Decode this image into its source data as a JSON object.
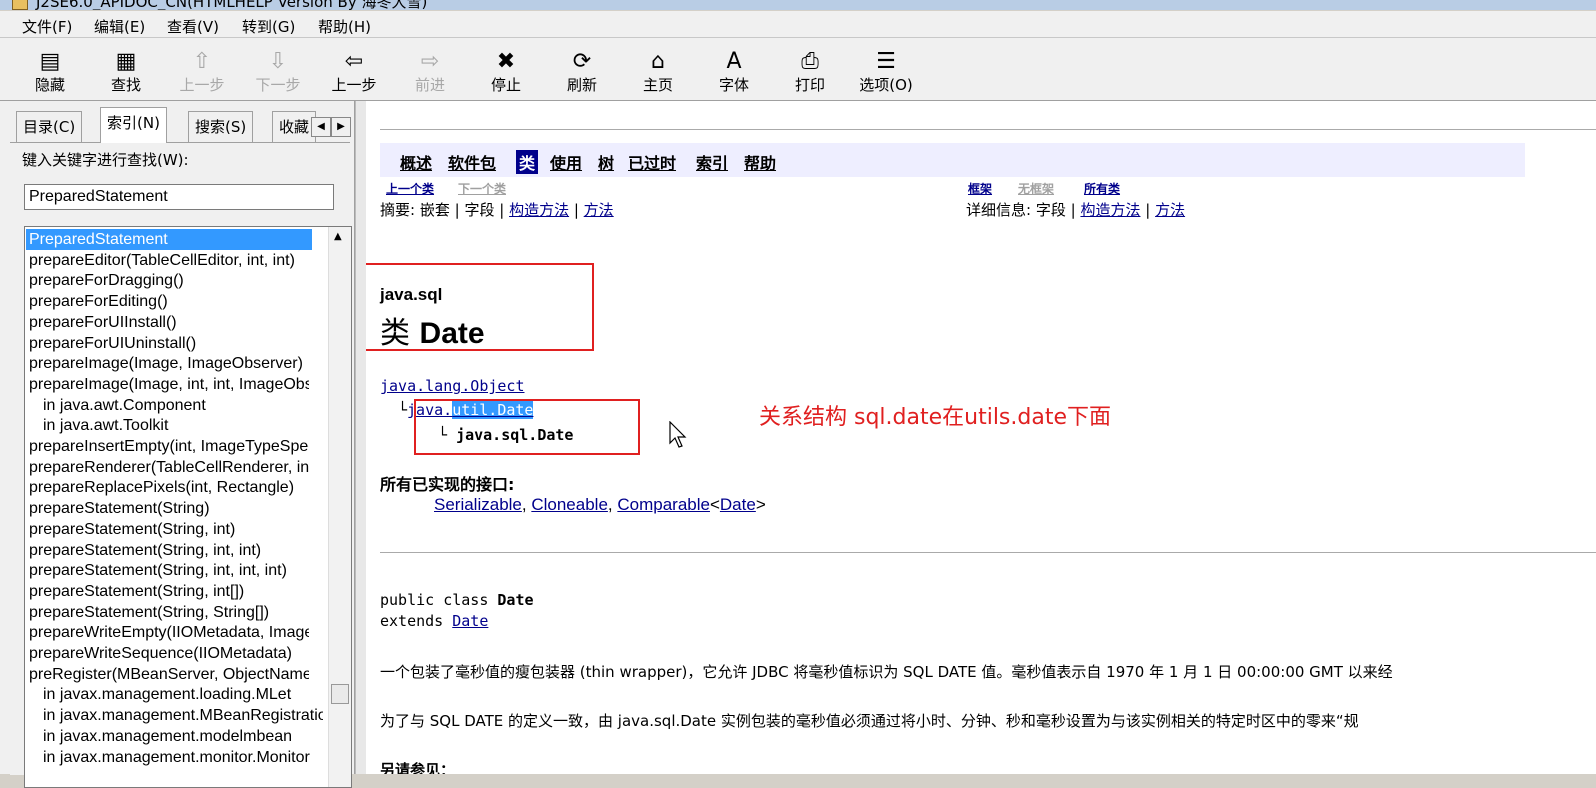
{
  "window": {
    "title": "J2SE6.0_APIDOC_CN(HTMLHELP Version By 海冬大雪)"
  },
  "menu": [
    "文件(F)",
    "编辑(E)",
    "查看(V)",
    "转到(G)",
    "帮助(H)"
  ],
  "toolbar": [
    {
      "label": "隐藏",
      "icon": "hide-icon",
      "glyph": "▤",
      "enabled": true
    },
    {
      "label": "查找",
      "icon": "locate-icon",
      "glyph": "▦",
      "enabled": true
    },
    {
      "label": "上一步",
      "icon": "up-arrow-icon",
      "glyph": "⇧",
      "enabled": false
    },
    {
      "label": "下一步",
      "icon": "down-arrow-icon",
      "glyph": "⇩",
      "enabled": false
    },
    {
      "label": "上一步",
      "icon": "back-arrow-icon",
      "glyph": "⇦",
      "enabled": true
    },
    {
      "label": "前进",
      "icon": "forward-arrow-icon",
      "glyph": "⇨",
      "enabled": false
    },
    {
      "label": "停止",
      "icon": "stop-icon",
      "glyph": "✖",
      "enabled": true
    },
    {
      "label": "刷新",
      "icon": "refresh-icon",
      "glyph": "⟳",
      "enabled": true
    },
    {
      "label": "主页",
      "icon": "home-icon",
      "glyph": "⌂",
      "enabled": true
    },
    {
      "label": "字体",
      "icon": "font-icon",
      "glyph": "A",
      "enabled": true
    },
    {
      "label": "打印",
      "icon": "print-icon",
      "glyph": "⎙",
      "enabled": true
    },
    {
      "label": "选项(O)",
      "icon": "options-icon",
      "glyph": "☰",
      "enabled": true
    }
  ],
  "tabs": [
    "目录(C)",
    "索引(N)",
    "搜索(S)",
    "收藏"
  ],
  "index": {
    "label": "键入关键字进行查找(W):",
    "query": "PreparedStatement",
    "items": [
      {
        "text": "PreparedStatement",
        "sub": false
      },
      {
        "text": "prepareEditor(TableCellEditor, int, int)",
        "sub": false
      },
      {
        "text": "prepareForDragging()",
        "sub": false
      },
      {
        "text": "prepareForEditing()",
        "sub": false
      },
      {
        "text": "prepareForUIInstall()",
        "sub": false
      },
      {
        "text": "prepareForUIUninstall()",
        "sub": false
      },
      {
        "text": "prepareImage(Image, ImageObserver)",
        "sub": false
      },
      {
        "text": "prepareImage(Image, int, int, ImageObserver)",
        "sub": false
      },
      {
        "text": "in java.awt.Component",
        "sub": true
      },
      {
        "text": "in java.awt.Toolkit",
        "sub": true
      },
      {
        "text": "prepareInsertEmpty(int, ImageTypeSpecifier)",
        "sub": false
      },
      {
        "text": "prepareRenderer(TableCellRenderer, int, int)",
        "sub": false
      },
      {
        "text": "prepareReplacePixels(int, Rectangle)",
        "sub": false
      },
      {
        "text": "prepareStatement(String)",
        "sub": false
      },
      {
        "text": "prepareStatement(String, int)",
        "sub": false
      },
      {
        "text": "prepareStatement(String, int, int)",
        "sub": false
      },
      {
        "text": "prepareStatement(String, int, int, int)",
        "sub": false
      },
      {
        "text": "prepareStatement(String, int[])",
        "sub": false
      },
      {
        "text": "prepareStatement(String, String[])",
        "sub": false
      },
      {
        "text": "prepareWriteEmpty(IIOMetadata, ImageTypeSpecifier)",
        "sub": false
      },
      {
        "text": "prepareWriteSequence(IIOMetadata)",
        "sub": false
      },
      {
        "text": "preRegister(MBeanServer, ObjectName)",
        "sub": false
      },
      {
        "text": "in javax.management.loading.MLet",
        "sub": true
      },
      {
        "text": "in javax.management.MBeanRegistration",
        "sub": true
      },
      {
        "text": "in javax.management.modelmbean",
        "sub": true
      },
      {
        "text": "in javax.management.monitor.Monitor",
        "sub": true
      }
    ]
  },
  "doc": {
    "nav": [
      "概述",
      "软件包",
      "类",
      "使用",
      "树",
      "已过时",
      "索引",
      "帮助"
    ],
    "nav_current": "类",
    "prev_class": "上一个类",
    "next_class": "下一个类",
    "frames": "框架",
    "no_frames": "无框架",
    "all_classes": "所有类",
    "summary_label": "摘要:",
    "summary_nested": "嵌套",
    "summary_field": "字段",
    "summary_ctor": "构造方法",
    "summary_method": "方法",
    "detail_label": "详细信息:",
    "detail_field": "字段",
    "detail_ctor": "构造方法",
    "detail_method": "方法",
    "package": "java.sql",
    "class_prefix": "类",
    "class_name": "Date",
    "hier_root": "java.lang.Object",
    "hier_mid_a": "java.",
    "hier_mid_b": "util.Date",
    "hier_leaf": "java.sql.Date",
    "annotation": "关系结构     sql.date在utils.date下面",
    "interfaces_heading": "所有已实现的接口:",
    "interfaces": [
      "Serializable",
      "Cloneable",
      "Comparable"
    ],
    "interface_generic": "Date",
    "decl_line1_a": "public class ",
    "decl_line1_b": "Date",
    "decl_line2_a": "extends ",
    "decl_line2_b": "Date",
    "para1": "一个包装了毫秒值的瘦包装器 (thin wrapper)，它允许 JDBC 将毫秒值标识为 SQL DATE 值。毫秒值表示自 1970 年 1 月 1 日 00:00:00 GMT 以来经",
    "para2": "为了与 SQL DATE 的定义一致，由 java.sql.Date 实例包装的毫秒值必须通过将小时、分钟、秒和毫秒设置为与该实例相关的特定时区中的零来“规",
    "para3": "另请参见："
  }
}
